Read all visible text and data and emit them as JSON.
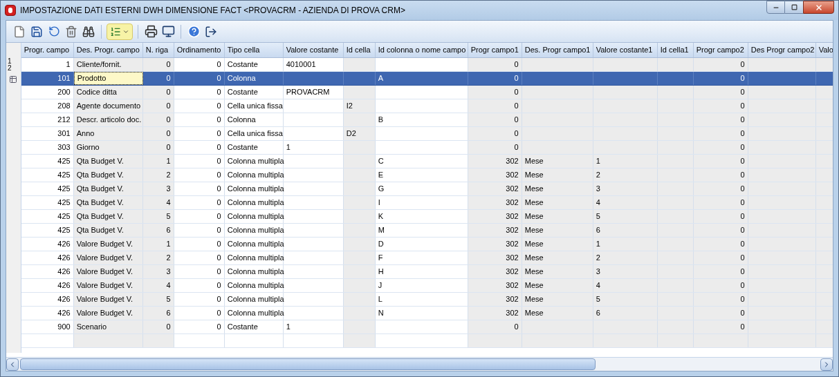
{
  "window": {
    "title": "IMPOSTAZIONE DATI ESTERNI DWH DIMENSIONE FACT <PROVACRM - AZIENDA DI PROVA CRM>"
  },
  "toolbar": [
    {
      "kind": "new"
    },
    {
      "kind": "save"
    },
    {
      "kind": "undo"
    },
    {
      "kind": "delete"
    },
    {
      "kind": "find"
    },
    {
      "kind": "sep"
    },
    {
      "kind": "list",
      "highlighted": true
    },
    {
      "kind": "sep"
    },
    {
      "kind": "print"
    },
    {
      "kind": "preview"
    },
    {
      "kind": "sep"
    },
    {
      "kind": "help"
    },
    {
      "kind": "exit"
    }
  ],
  "gutter": [
    "1",
    "2"
  ],
  "table": {
    "columns": [
      {
        "label": "Progr. campo",
        "kind": "number",
        "shaded": false,
        "current": false
      },
      {
        "label": "Des. Progr. campo",
        "kind": "text",
        "shaded": true,
        "current": true
      },
      {
        "label": "N. riga",
        "kind": "number",
        "shaded": true,
        "current": false
      },
      {
        "label": "Ordinamento",
        "kind": "number",
        "shaded": false,
        "current": false
      },
      {
        "label": "Tipo cella",
        "kind": "text",
        "shaded": false,
        "current": false
      },
      {
        "label": "Valore costante",
        "kind": "text",
        "shaded": false,
        "current": false
      },
      {
        "label": "Id cella",
        "kind": "text",
        "shaded": true,
        "current": false
      },
      {
        "label": "Id colonna o nome campo",
        "kind": "text",
        "shaded": false,
        "current": false
      },
      {
        "label": "Progr campo1",
        "kind": "number",
        "shaded": true,
        "current": false
      },
      {
        "label": "Des. Progr campo1",
        "kind": "text",
        "shaded": true,
        "current": false
      },
      {
        "label": "Valore costante1",
        "kind": "text",
        "shaded": true,
        "current": false
      },
      {
        "label": "Id cella1",
        "kind": "text",
        "shaded": true,
        "current": false
      },
      {
        "label": "Progr campo2",
        "kind": "number",
        "shaded": true,
        "current": false
      },
      {
        "label": "Des Progr campo2",
        "kind": "text",
        "shaded": true,
        "current": false
      },
      {
        "label": "Valo",
        "kind": "text",
        "shaded": true,
        "current": false
      }
    ],
    "rows": [
      {
        "selected": false,
        "cells": [
          "1",
          "Cliente/fornit.",
          "0",
          "0",
          "Costante",
          "4010001",
          null,
          null,
          "0",
          null,
          null,
          null,
          "0"
        ]
      },
      {
        "selected": true,
        "cells": [
          "101",
          "Prodotto",
          "0",
          "0",
          "Colonna",
          null,
          null,
          "A",
          "0",
          null,
          null,
          null,
          "0"
        ]
      },
      {
        "selected": false,
        "cells": [
          "200",
          "Codice ditta",
          "0",
          "0",
          "Costante",
          "PROVACRM",
          null,
          null,
          "0",
          null,
          null,
          null,
          "0"
        ]
      },
      {
        "selected": false,
        "cells": [
          "208",
          "Agente documento",
          "0",
          "0",
          "Cella unica fissa",
          null,
          "I2",
          null,
          "0",
          null,
          null,
          null,
          "0"
        ]
      },
      {
        "selected": false,
        "cells": [
          "212",
          "Descr. articolo doc.",
          "0",
          "0",
          "Colonna",
          null,
          null,
          "B",
          "0",
          null,
          null,
          null,
          "0"
        ]
      },
      {
        "selected": false,
        "cells": [
          "301",
          "Anno",
          "0",
          "0",
          "Cella unica fissa",
          null,
          "D2",
          null,
          "0",
          null,
          null,
          null,
          "0"
        ]
      },
      {
        "selected": false,
        "cells": [
          "303",
          "Giorno",
          "0",
          "0",
          "Costante",
          "1",
          null,
          null,
          "0",
          null,
          null,
          null,
          "0"
        ]
      },
      {
        "selected": false,
        "cells": [
          "425",
          "Qta Budget V.",
          "1",
          "0",
          "Colonna multipla",
          null,
          null,
          "C",
          "302",
          "Mese",
          "1",
          null,
          "0"
        ]
      },
      {
        "selected": false,
        "cells": [
          "425",
          "Qta Budget V.",
          "2",
          "0",
          "Colonna multipla",
          null,
          null,
          "E",
          "302",
          "Mese",
          "2",
          null,
          "0"
        ]
      },
      {
        "selected": false,
        "cells": [
          "425",
          "Qta Budget V.",
          "3",
          "0",
          "Colonna multipla",
          null,
          null,
          "G",
          "302",
          "Mese",
          "3",
          null,
          "0"
        ]
      },
      {
        "selected": false,
        "cells": [
          "425",
          "Qta Budget V.",
          "4",
          "0",
          "Colonna multipla",
          null,
          null,
          "I",
          "302",
          "Mese",
          "4",
          null,
          "0"
        ]
      },
      {
        "selected": false,
        "cells": [
          "425",
          "Qta Budget V.",
          "5",
          "0",
          "Colonna multipla",
          null,
          null,
          "K",
          "302",
          "Mese",
          "5",
          null,
          "0"
        ]
      },
      {
        "selected": false,
        "cells": [
          "425",
          "Qta Budget V.",
          "6",
          "0",
          "Colonna multipla",
          null,
          null,
          "M",
          "302",
          "Mese",
          "6",
          null,
          "0"
        ]
      },
      {
        "selected": false,
        "cells": [
          "426",
          "Valore Budget V.",
          "1",
          "0",
          "Colonna multipla",
          null,
          null,
          "D",
          "302",
          "Mese",
          "1",
          null,
          "0"
        ]
      },
      {
        "selected": false,
        "cells": [
          "426",
          "Valore Budget V.",
          "2",
          "0",
          "Colonna multipla",
          null,
          null,
          "F",
          "302",
          "Mese",
          "2",
          null,
          "0"
        ]
      },
      {
        "selected": false,
        "cells": [
          "426",
          "Valore Budget V.",
          "3",
          "0",
          "Colonna multipla",
          null,
          null,
          "H",
          "302",
          "Mese",
          "3",
          null,
          "0"
        ]
      },
      {
        "selected": false,
        "cells": [
          "426",
          "Valore Budget V.",
          "4",
          "0",
          "Colonna multipla",
          null,
          null,
          "J",
          "302",
          "Mese",
          "4",
          null,
          "0"
        ]
      },
      {
        "selected": false,
        "cells": [
          "426",
          "Valore Budget V.",
          "5",
          "0",
          "Colonna multipla",
          null,
          null,
          "L",
          "302",
          "Mese",
          "5",
          null,
          "0"
        ]
      },
      {
        "selected": false,
        "cells": [
          "426",
          "Valore Budget V.",
          "6",
          "0",
          "Colonna multipla",
          null,
          null,
          "N",
          "302",
          "Mese",
          "6",
          null,
          "0"
        ]
      },
      {
        "selected": false,
        "cells": [
          "900",
          "Scenario",
          "0",
          "0",
          "Costante",
          "1",
          null,
          null,
          "0",
          null,
          null,
          null,
          "0"
        ]
      }
    ]
  }
}
